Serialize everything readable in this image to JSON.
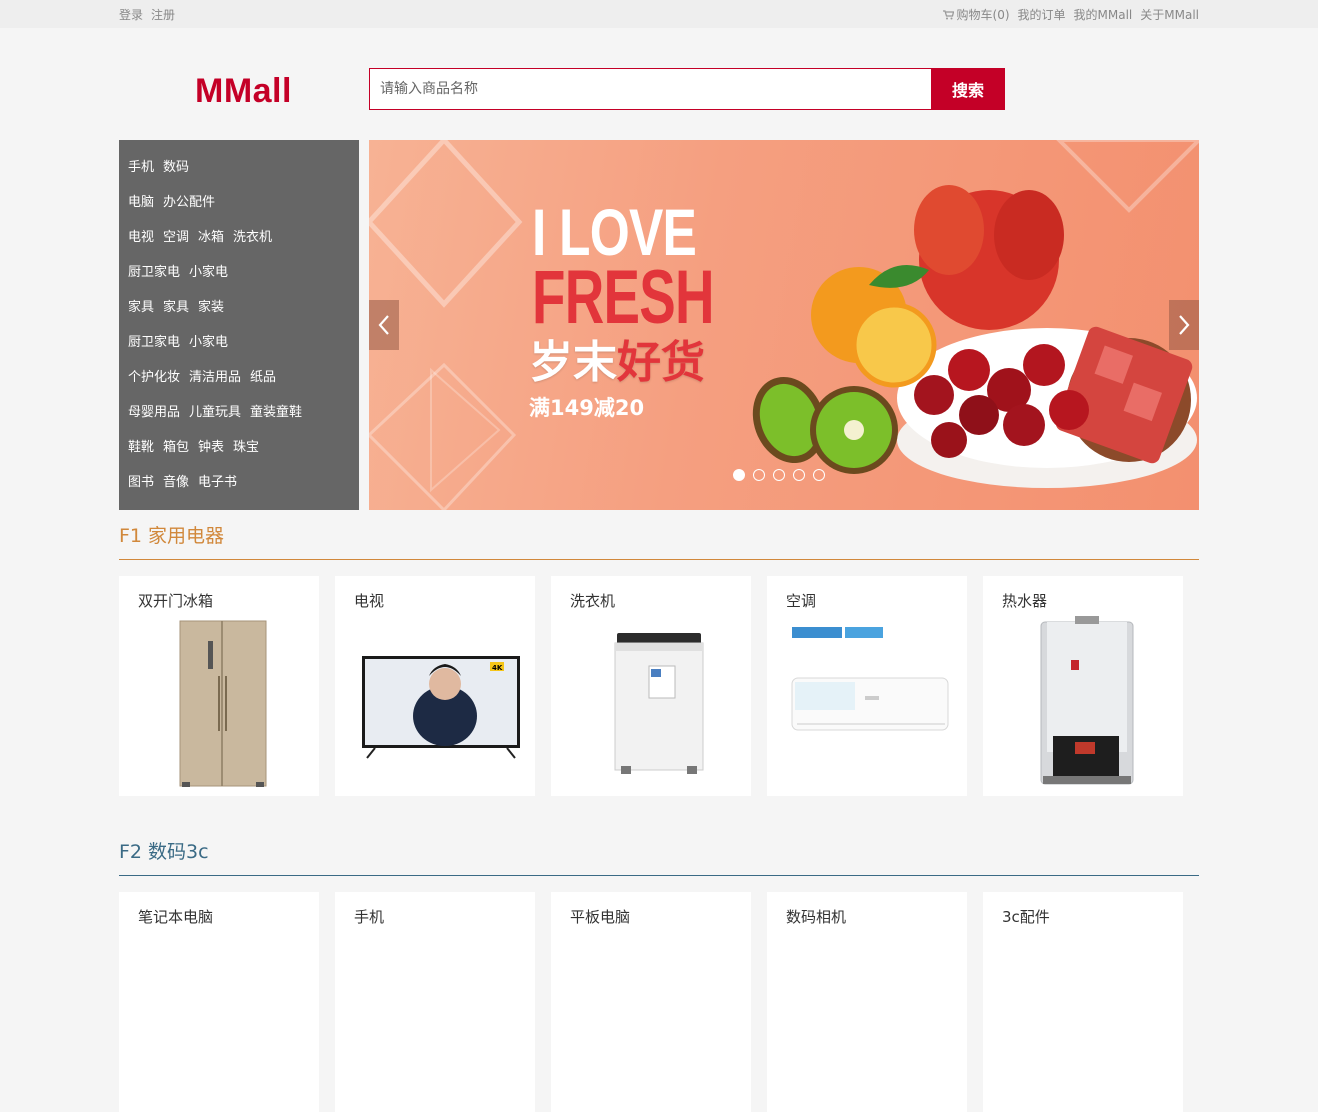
{
  "topbar": {
    "login": "登录",
    "register": "注册",
    "cart": "购物车(0)",
    "orders": "我的订单",
    "my_mmall": "我的MMall",
    "about": "关于MMall"
  },
  "header": {
    "logo": "MMall",
    "search_placeholder": "请输入商品名称",
    "search_button": "搜索"
  },
  "categories": [
    [
      "手机",
      "数码"
    ],
    [
      "电脑",
      "办公配件"
    ],
    [
      "电视",
      "空调",
      "冰箱",
      "洗衣机"
    ],
    [
      "厨卫家电",
      "小家电"
    ],
    [
      "家具",
      "家具",
      "家装"
    ],
    [
      "厨卫家电",
      "小家电"
    ],
    [
      "个护化妆",
      "清洁用品",
      "纸品"
    ],
    [
      "母婴用品",
      "儿童玩具",
      "童装童鞋"
    ],
    [
      "鞋靴",
      "箱包",
      "钟表",
      "珠宝"
    ],
    [
      "图书",
      "音像",
      "电子书"
    ]
  ],
  "banner": {
    "line1": "I LOVE",
    "line2": "FRESH",
    "line3a": "岁末",
    "line3b": "好货",
    "line4": "满149减20",
    "slide_count": 5,
    "active_slide": 1
  },
  "floors": [
    {
      "title": "F1 家用电器",
      "color": "#d1883b",
      "items": [
        "双开门冰箱",
        "电视",
        "洗衣机",
        "空调",
        "热水器"
      ]
    },
    {
      "title": "F2 数码3c",
      "color": "#3a6a85",
      "items": [
        "笔记本电脑",
        "手机",
        "平板电脑",
        "数码相机",
        "3c配件"
      ]
    }
  ],
  "tv_tag": "4K"
}
